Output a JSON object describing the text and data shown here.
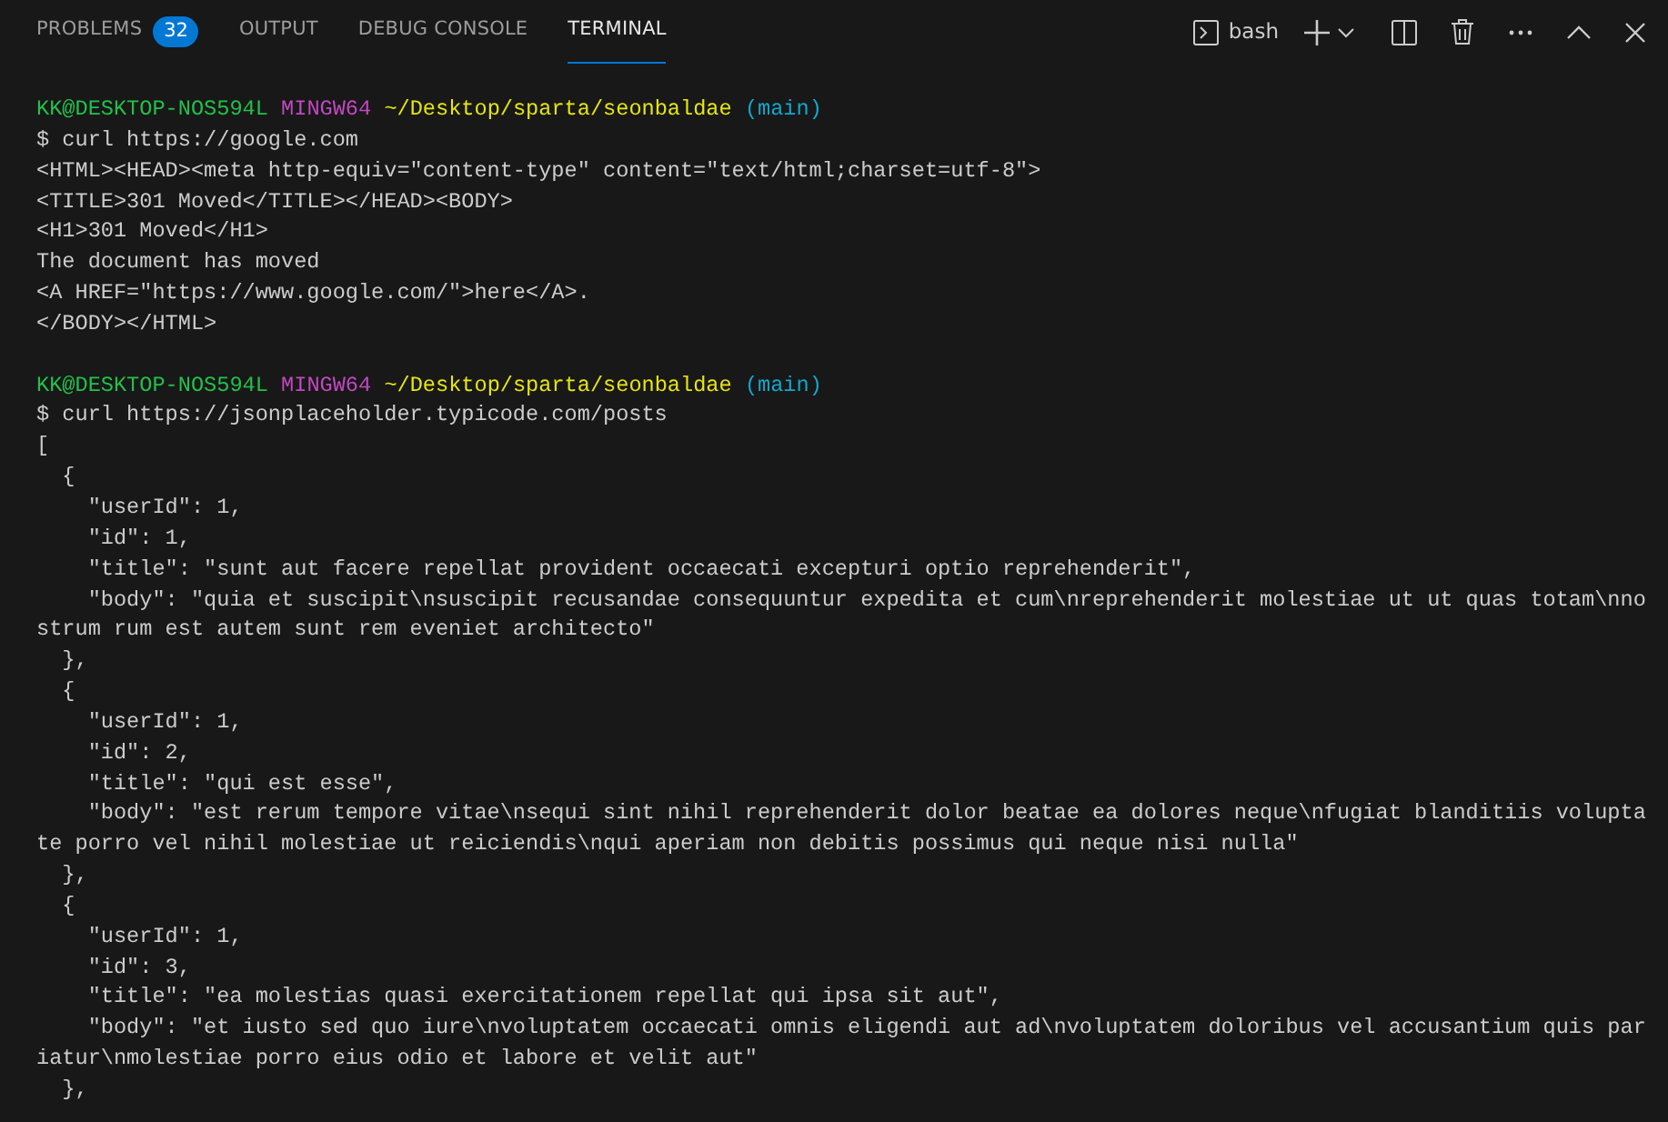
{
  "panel_tabs": [
    {
      "label": "PROBLEMS",
      "badge": "32",
      "selected": false
    },
    {
      "label": "OUTPUT",
      "selected": false
    },
    {
      "label": "DEBUG CONSOLE",
      "selected": false
    },
    {
      "label": "TERMINAL",
      "selected": true
    }
  ],
  "terminal_profile": {
    "label": "bash"
  },
  "terminal_lines": [
    {
      "kind": "prompt",
      "user_host": "KK@DESKTOP-NOS594L",
      "system": "MINGW64",
      "path": "~/Desktop/sparta/seonbaldae",
      "branch": "(main)"
    },
    {
      "kind": "text",
      "text": "$ curl https://google.com"
    },
    {
      "kind": "text",
      "text": "<HTML><HEAD><meta http-equiv=\"content-type\" content=\"text/html;charset=utf-8\">"
    },
    {
      "kind": "text",
      "text": "<TITLE>301 Moved</TITLE></HEAD><BODY>"
    },
    {
      "kind": "text",
      "text": "<H1>301 Moved</H1>"
    },
    {
      "kind": "text",
      "text": "The document has moved"
    },
    {
      "kind": "text",
      "text": "<A HREF=\"https://www.google.com/\">here</A>."
    },
    {
      "kind": "text",
      "text": "</BODY></HTML>"
    },
    {
      "kind": "blank"
    },
    {
      "kind": "prompt",
      "user_host": "KK@DESKTOP-NOS594L",
      "system": "MINGW64",
      "path": "~/Desktop/sparta/seonbaldae",
      "branch": "(main)"
    },
    {
      "kind": "text",
      "text": "$ curl https://jsonplaceholder.typicode.com/posts"
    },
    {
      "kind": "text",
      "text": "["
    },
    {
      "kind": "text",
      "text": "  {"
    },
    {
      "kind": "text",
      "text": "    \"userId\": 1,"
    },
    {
      "kind": "text",
      "text": "    \"id\": 1,"
    },
    {
      "kind": "text",
      "text": "    \"title\": \"sunt aut facere repellat provident occaecati excepturi optio reprehenderit\","
    },
    {
      "kind": "text",
      "text": "    \"body\": \"quia et suscipit\\nsuscipit recusandae consequuntur expedita et cum\\nreprehenderit molestiae ut ut quas totam\\nno"
    },
    {
      "kind": "text",
      "text": "strum rum est autem sunt rem eveniet architecto\""
    },
    {
      "kind": "text",
      "text": "  },"
    },
    {
      "kind": "text",
      "text": "  {"
    },
    {
      "kind": "text",
      "text": "    \"userId\": 1,"
    },
    {
      "kind": "text",
      "text": "    \"id\": 2,"
    },
    {
      "kind": "text",
      "text": "    \"title\": \"qui est esse\","
    },
    {
      "kind": "text",
      "text": "    \"body\": \"est rerum tempore vitae\\nsequi sint nihil reprehenderit dolor beatae ea dolores neque\\nfugiat blanditiis volupta"
    },
    {
      "kind": "text",
      "text": "te porro vel nihil molestiae ut reiciendis\\nqui aperiam non debitis possimus qui neque nisi nulla\""
    },
    {
      "kind": "text",
      "text": "  },"
    },
    {
      "kind": "text",
      "text": "  {"
    },
    {
      "kind": "text",
      "text": "    \"userId\": 1,"
    },
    {
      "kind": "text",
      "text": "    \"id\": 3,"
    },
    {
      "kind": "text",
      "text": "    \"title\": \"ea molestias quasi exercitationem repellat qui ipsa sit aut\","
    },
    {
      "kind": "text",
      "text": "    \"body\": \"et iusto sed quo iure\\nvoluptatem occaecati omnis eligendi aut ad\\nvoluptatem doloribus vel accusantium quis par"
    },
    {
      "kind": "text",
      "text": "iatur\\nmolestiae porro eius odio et labore et velit aut\""
    },
    {
      "kind": "text",
      "text": "  },"
    }
  ]
}
